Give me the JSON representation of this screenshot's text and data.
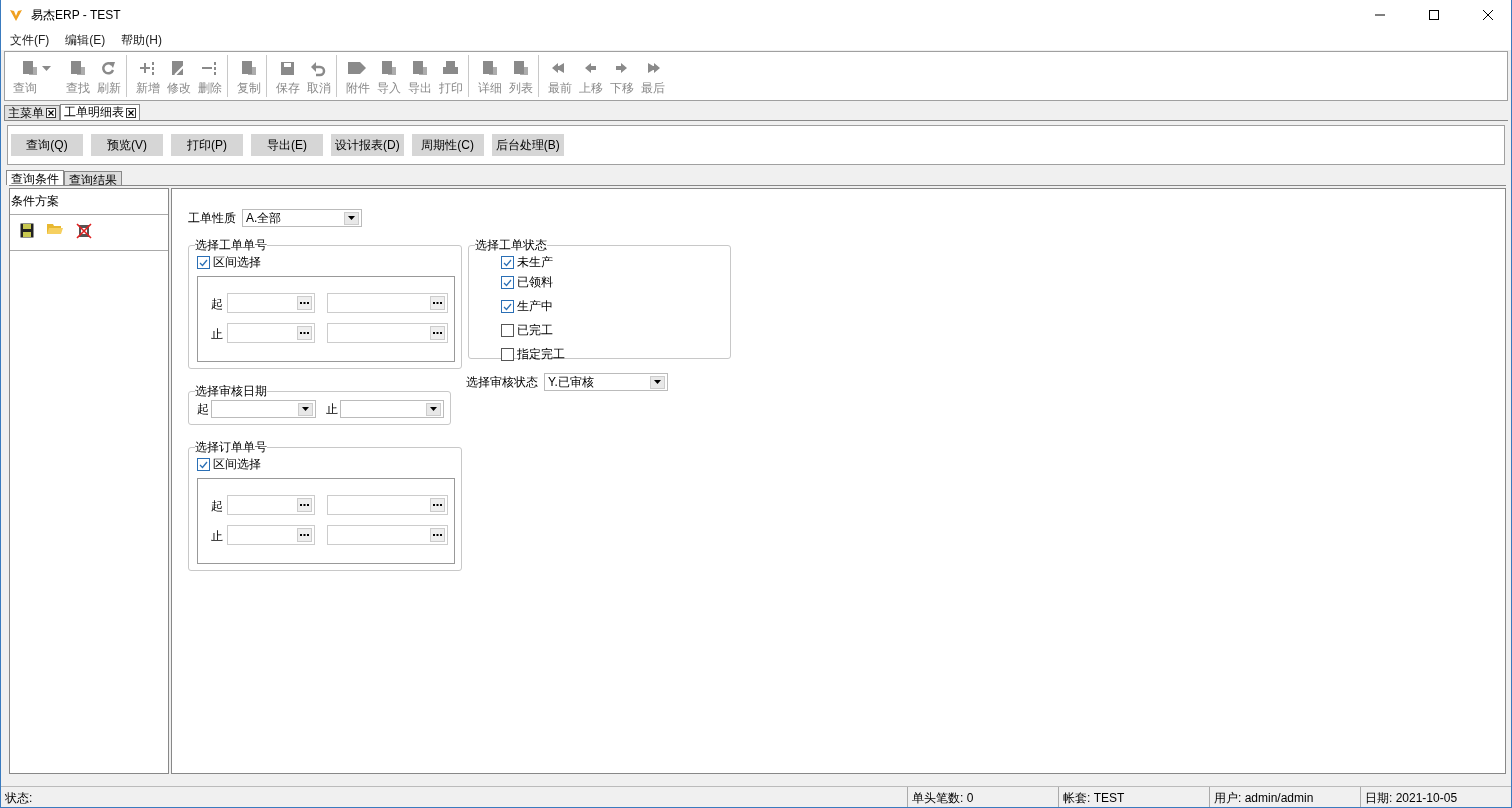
{
  "window": {
    "title": "易杰ERP - TEST"
  },
  "menu": [
    "文件(F)",
    "编辑(E)",
    "帮助(H)"
  ],
  "toolbar": {
    "groups": [
      [
        {
          "label": "查询",
          "disabled": true,
          "dropdown": true
        },
        {
          "label": "查找",
          "disabled": true,
          "dropdown": false
        },
        {
          "label": "刷新",
          "disabled": true,
          "dropdown": false
        }
      ],
      [
        {
          "label": "新增",
          "disabled": true,
          "dropdown": false
        },
        {
          "label": "修改",
          "disabled": true,
          "dropdown": false
        },
        {
          "label": "删除",
          "disabled": true,
          "dropdown": false
        }
      ],
      [
        {
          "label": "复制",
          "disabled": true,
          "dropdown": false
        }
      ],
      [
        {
          "label": "保存",
          "disabled": true,
          "dropdown": false
        },
        {
          "label": "取消",
          "disabled": true,
          "dropdown": false
        }
      ],
      [
        {
          "label": "附件",
          "disabled": true,
          "dropdown": false
        },
        {
          "label": "导入",
          "disabled": true,
          "dropdown": false
        },
        {
          "label": "导出",
          "disabled": true,
          "dropdown": false
        },
        {
          "label": "打印",
          "disabled": true,
          "dropdown": false
        }
      ],
      [
        {
          "label": "详细",
          "disabled": true,
          "dropdown": false
        },
        {
          "label": "列表",
          "disabled": true,
          "dropdown": false
        }
      ],
      [
        {
          "label": "最前",
          "disabled": true,
          "dropdown": false
        },
        {
          "label": "上移",
          "disabled": true,
          "dropdown": false
        },
        {
          "label": "下移",
          "disabled": true,
          "dropdown": false
        },
        {
          "label": "最后",
          "disabled": true,
          "dropdown": false
        }
      ]
    ]
  },
  "doc_tabs": [
    {
      "label": "主菜单",
      "selected": false
    },
    {
      "label": "工单明细表",
      "selected": true
    }
  ],
  "actions": [
    "查询(Q)",
    "预览(V)",
    "打印(P)",
    "导出(E)",
    "设计报表(D)",
    "周期性(C)",
    "后台处理(B)"
  ],
  "sub_tabs": [
    {
      "label": "查询条件",
      "selected": true
    },
    {
      "label": "查询结果",
      "selected": false
    }
  ],
  "scheme_panel": {
    "title": "条件方案"
  },
  "form": {
    "order_type": {
      "label": "工单性质",
      "value": "A.全部"
    },
    "work_order_no": {
      "title": "选择工单单号",
      "range": {
        "label": "区间选择",
        "checked": true
      },
      "from_label": "起",
      "to_label": "止"
    },
    "audit_date": {
      "title": "选择审核日期",
      "from_label": "起",
      "to_label": "止"
    },
    "sales_order_no": {
      "title": "选择订单单号",
      "range": {
        "label": "区间选择",
        "checked": true
      },
      "from_label": "起",
      "to_label": "止"
    },
    "work_order_status": {
      "title": "选择工单状态",
      "options": [
        {
          "label": "未生产",
          "checked": true
        },
        {
          "label": "已领料",
          "checked": true
        },
        {
          "label": "生产中",
          "checked": true
        },
        {
          "label": "已完工",
          "checked": false
        },
        {
          "label": "指定完工",
          "checked": false
        }
      ]
    },
    "audit_status": {
      "label": "选择审核状态",
      "value": "Y.已审核"
    }
  },
  "status_bar": [
    "状态:",
    "单头笔数: 0",
    "帐套: TEST",
    "用户: admin/admin",
    "日期: 2021-10-05"
  ]
}
